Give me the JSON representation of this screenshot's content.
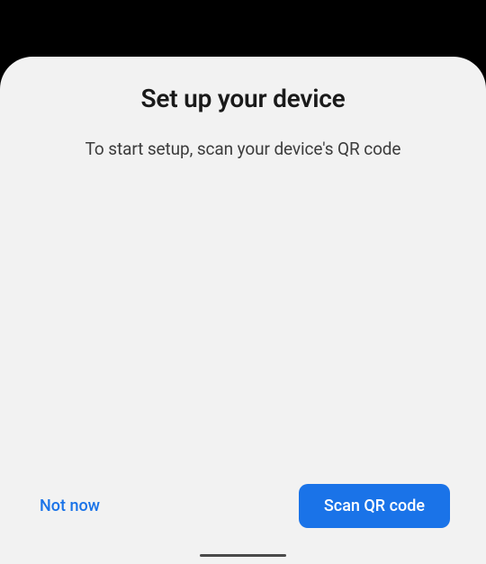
{
  "dialog": {
    "title": "Set up your device",
    "subtitle": "To start setup, scan your device's QR code"
  },
  "actions": {
    "dismiss_label": "Not now",
    "primary_label": "Scan QR code"
  },
  "colors": {
    "accent": "#1a73e8",
    "sheet_bg": "#f2f2f2",
    "backdrop": "#000000"
  }
}
